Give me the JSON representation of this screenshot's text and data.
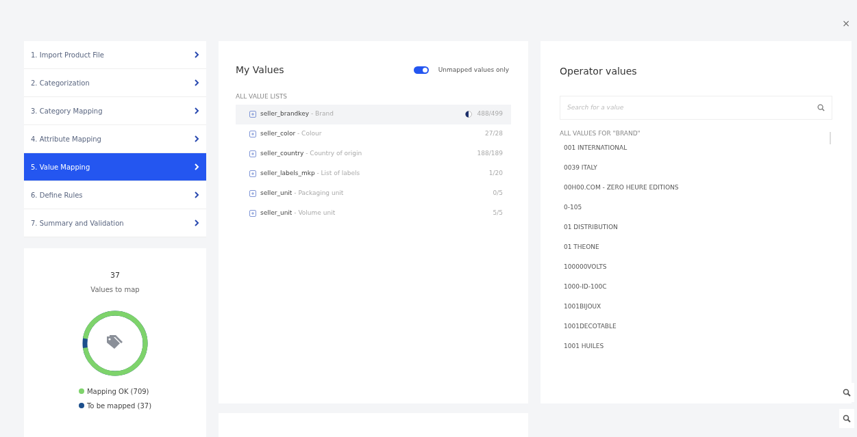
{
  "close_label": "×",
  "steps": [
    {
      "label": "1. Import Product File",
      "selected": false
    },
    {
      "label": "2. Categorization",
      "selected": false
    },
    {
      "label": "3. Category Mapping",
      "selected": false
    },
    {
      "label": "4. Attribute Mapping",
      "selected": false
    },
    {
      "label": "5. Value Mapping",
      "selected": true
    },
    {
      "label": "6. Define Rules",
      "selected": false
    },
    {
      "label": "7. Summary and Validation",
      "selected": false
    }
  ],
  "summary": {
    "count": "37",
    "caption": "Values to map",
    "donut": {
      "level": 0.95
    },
    "legend": [
      {
        "label": "Mapping OK (709)",
        "color": "#7ed36b"
      },
      {
        "label": "To be mapped (37)",
        "color": "#1c4f8c"
      }
    ]
  },
  "my_values": {
    "title": "My Values",
    "toggle": {
      "label": "Unmapped values only",
      "on": true
    },
    "section": "ALL VALUE LISTS",
    "rows": [
      {
        "key": "seller_brandkey",
        "name": "- Brand",
        "count": "488/499",
        "selected": true
      },
      {
        "key": "seller_color",
        "name": "- Colour",
        "count": "27/28",
        "selected": false
      },
      {
        "key": "seller_country",
        "name": "- Country of origin",
        "count": "188/189",
        "selected": false
      },
      {
        "key": "seller_labels_mkp",
        "name": "- List of labels",
        "count": "1/20",
        "selected": false
      },
      {
        "key": "seller_unit",
        "name": "- Packaging unit",
        "count": "0/5",
        "selected": false
      },
      {
        "key": "seller_unit",
        "name": "- Volume unit",
        "count": "5/5",
        "selected": false
      }
    ]
  },
  "operator_values": {
    "title": "Operator values",
    "search": {
      "placeholder": "Search for a value"
    },
    "section": "ALL VALUES FOR \"BRAND\"",
    "items": [
      "001 INTERNATIONAL",
      "0039 ITALY",
      "00H00.COM - ZERO HEURE EDITIONS",
      "0-105",
      "01 DISTRIBUTION",
      "01 THEONE",
      "100000VOLTS",
      "1000-ID-100C",
      "1001BIJOUX",
      "1001DECOTABLE",
      "1001 HUILES"
    ]
  }
}
